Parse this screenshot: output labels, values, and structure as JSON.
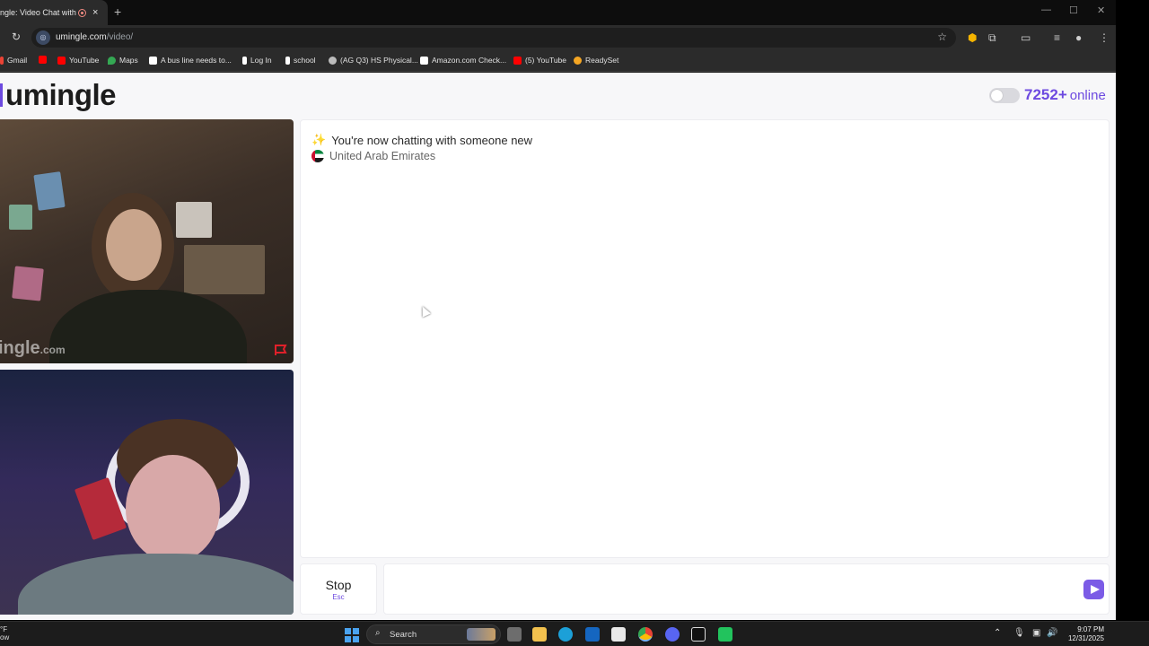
{
  "browser": {
    "tab_title": "ngle: Video Chat with S",
    "tab_close": "×",
    "new_tab": "+",
    "url_host": "umingle.com",
    "url_path": "/video/",
    "window_controls": [
      "—",
      "☐",
      "✕"
    ]
  },
  "bookmarks": [
    {
      "label": "Gmail",
      "color": "#ea4335"
    },
    {
      "label": "",
      "color": "#ff0000"
    },
    {
      "label": "YouTube",
      "color": "#ff0000"
    },
    {
      "label": "Maps",
      "color": "#34a853"
    },
    {
      "label": "A bus line needs to...",
      "color": "#ffffff"
    },
    {
      "label": "Log In",
      "color": "#ffffff"
    },
    {
      "label": "school",
      "color": "#ffffff"
    },
    {
      "label": "(AG Q3) HS Physical...",
      "color": "#bbbbbb"
    },
    {
      "label": "Amazon.com Check...",
      "color": "#ffffff"
    },
    {
      "label": "(5) YouTube",
      "color": "#ff0000"
    },
    {
      "label": "ReadySet",
      "color": "#f5a623"
    }
  ],
  "site": {
    "logo": "umingle",
    "online_count": "7252+",
    "online_label": "online",
    "watermark_main": "ingle",
    "watermark_suffix": ".com",
    "accent_color": "#6d4ae0"
  },
  "chat": {
    "system_message": "You're now chatting with someone new",
    "country": "United Arab Emirates",
    "input_placeholder": ""
  },
  "controls": {
    "stop_label": "Stop",
    "stop_shortcut": "Esc"
  },
  "taskbar": {
    "weather_line1": "°F",
    "weather_line2": "ow",
    "search_label": "Search",
    "time": "9:07 PM",
    "date": "12/31/2025"
  }
}
